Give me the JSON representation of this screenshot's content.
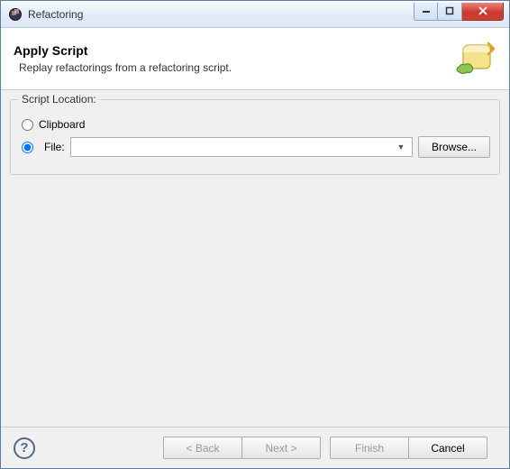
{
  "window": {
    "title": "Refactoring"
  },
  "banner": {
    "heading": "Apply Script",
    "description": "Replay refactorings from a refactoring script."
  },
  "group": {
    "legend": "Script Location:",
    "clipboard_label": "Clipboard",
    "file_label": "File:",
    "browse_label": "Browse..."
  },
  "footer": {
    "back": "< Back",
    "next": "Next >",
    "finish": "Finish",
    "cancel": "Cancel"
  }
}
